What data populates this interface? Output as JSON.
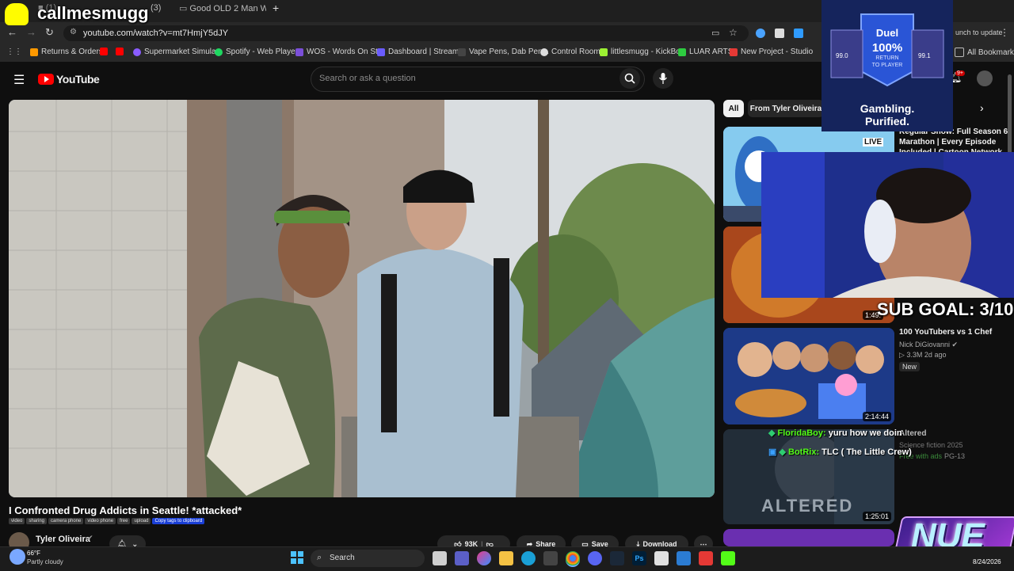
{
  "overlay": {
    "streamer_name": "callmesmugg",
    "sub_goal": "SUB GOAL: 3/10",
    "ad": {
      "title": "Duel",
      "pct": "100%",
      "line1": "RETURN",
      "line2": "TO PLAYER",
      "left_val": "99.0",
      "right_val": "99.1",
      "tagline1": "Gambling.",
      "tagline2": "Purified."
    },
    "chat": [
      {
        "user": "FloridaBoy:",
        "msg": "yuru how we doin"
      },
      {
        "user": "BotRix:",
        "msg": "TLC ( The Little Crew)"
      }
    ],
    "brand_logo": "NUE"
  },
  "browser": {
    "tabs": [
      "(3)",
      "Good OLD 2 Man W/"
    ],
    "new_tab": "+",
    "url": "youtube.com/watch?v=mt7HmjY5dJY",
    "relaunch": "unch to update",
    "bookmarks": [
      "Returns & Orders",
      "Supermarket Simula...",
      "Spotify - Web Playe...",
      "WOS - Words On St...",
      "Dashboard | Stream...",
      "Vape Pens, Dab Pen...",
      "Control Room",
      "littlesmugg - KickBot",
      "LUAR ARTS",
      "New Project - Studio"
    ],
    "all_bookmarks": "All Bookmarks"
  },
  "youtube": {
    "logo": "YouTube",
    "search_placeholder": "Search or ask a question",
    "notif_count": "9+",
    "video": {
      "title": "I Confronted Drug Addicts in Seattle! *attacked*",
      "tags": [
        "video",
        "sharing",
        "camera phone",
        "video phone",
        "free",
        "upload"
      ],
      "copy_tags": "Copy tags to clipboard",
      "channel": "Tyler Oliveira",
      "likes": "93K",
      "share": "Share",
      "save": "Save",
      "download": "Download"
    },
    "chips": [
      "All",
      "From Tyler Oliveira"
    ],
    "recs": [
      {
        "title_lines": [
          "Regular Show: Full Season 6",
          "Marathon | Every Episode",
          "Included | Cartoon Network"
        ],
        "live_badge": "LIVE"
      },
      {
        "duration": "1:49:"
      },
      {
        "title_lines": [
          "100 YouTubers vs 1 Chef"
        ],
        "channel": "Nick DiGiovanni",
        "stats": "3.3M  2d ago",
        "badge": "New",
        "duration": "2:14:44"
      },
      {
        "title_lines": [
          "Altered"
        ],
        "meta": "Science fiction 2025",
        "free": "Free with ads",
        "rating": "PG-13",
        "duration": "1:25:01",
        "poster_text": "ALTERED"
      }
    ]
  },
  "taskbar": {
    "temp": "66°F",
    "weather": "Partly cloudy",
    "search": "Search",
    "date": "8/24/2026"
  },
  "colors": {
    "yt_red": "#ff0000",
    "chat_user": "#53fc18",
    "sub_goal": "#ffffff",
    "ad_bg": "#1b2b6b"
  }
}
